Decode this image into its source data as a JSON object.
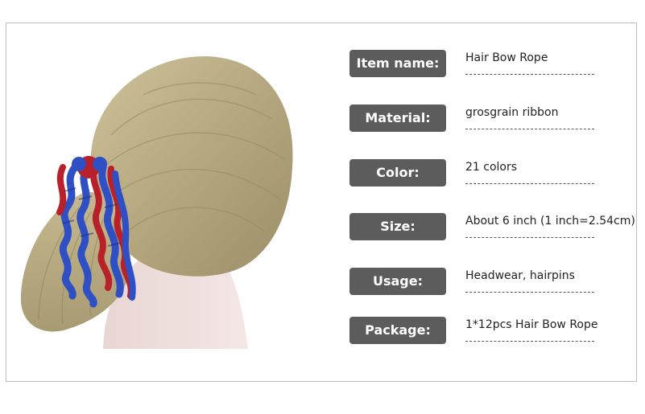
{
  "product": {
    "image_alt": "Ponytail with blue and red curly grosgrain ribbon hair bow"
  },
  "specs": [
    {
      "label": "Item name:",
      "value": "Hair Bow Rope"
    },
    {
      "label": "Material:",
      "value": "grosgrain ribbon"
    },
    {
      "label": "Color:",
      "value": "21 colors"
    },
    {
      "label": "Size:",
      "value": "About 6 inch (1 inch=2.54cm)"
    },
    {
      "label": "Usage:",
      "value": "Headwear, hairpins"
    },
    {
      "label": "Package:",
      "value": "1*12pcs Hair Bow Rope"
    }
  ],
  "colors": {
    "label_bg": "#5c5c5c",
    "ribbon_blue": "#2f4fc4",
    "ribbon_red": "#b8202a",
    "hair": "#b9ad86"
  }
}
